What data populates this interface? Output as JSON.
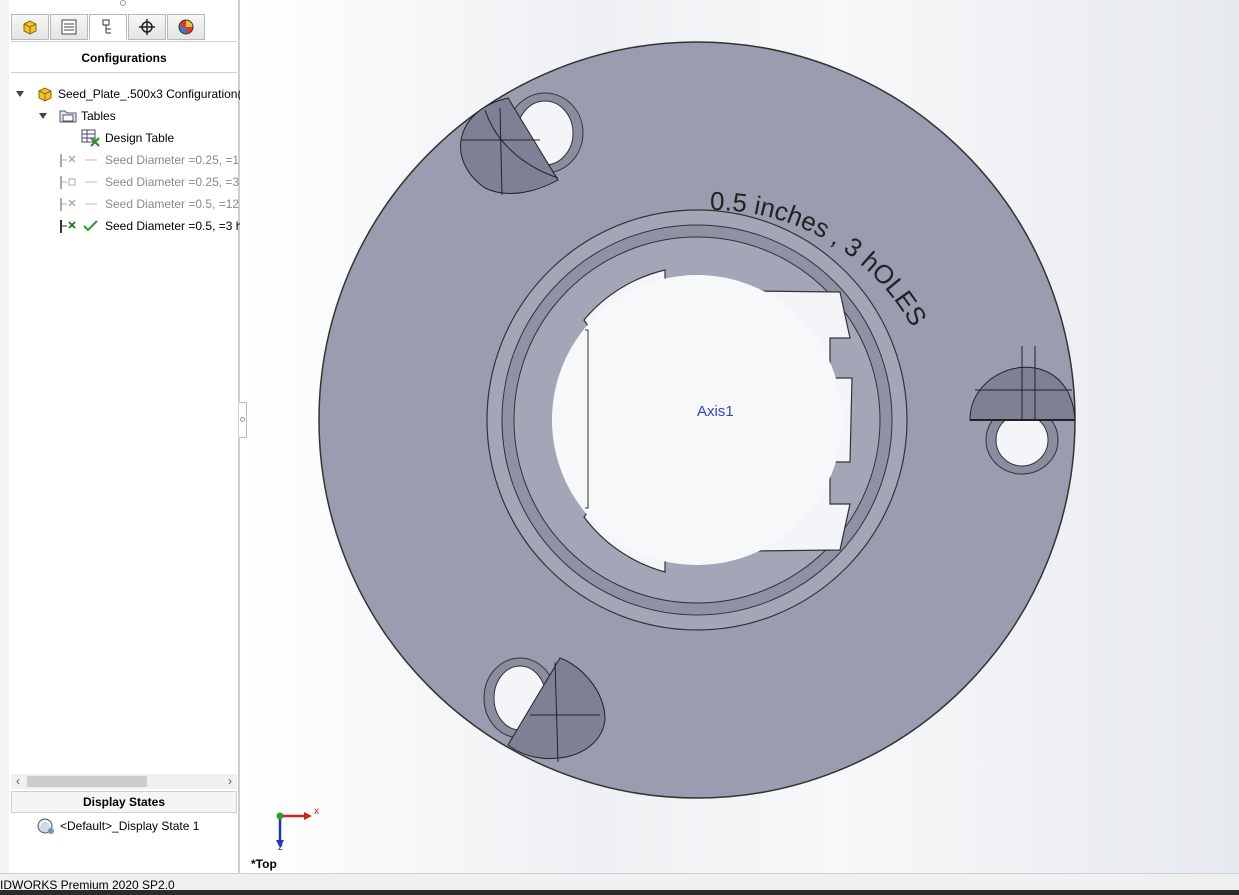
{
  "configuration_manager": {
    "header": "Configurations",
    "tabs": [
      "feature-manager-tab",
      "property-manager-tab",
      "configuration-manager-tab",
      "dimxpert-manager-tab",
      "display-manager-tab"
    ],
    "tree": {
      "root": "Seed_Plate_.500x3 Configuration(s",
      "tables_folder": "Tables",
      "design_table": "Design Table",
      "configurations": [
        {
          "label": "Seed Diameter =0.25, =1(",
          "active": false
        },
        {
          "label": "Seed Diameter =0.25, =3",
          "active": false
        },
        {
          "label": "Seed Diameter =0.5, =12",
          "active": false
        },
        {
          "label": "Seed Diameter =0.5, =3 h",
          "active": true
        }
      ]
    }
  },
  "display_states": {
    "header": "Display States",
    "items": [
      "<Default>_Display State 1"
    ]
  },
  "viewport": {
    "axis_label": "Axis1",
    "engraved_text": "0.5 inches , 3 hOLES",
    "view_orientation": "*Top",
    "triad": {
      "x": "x",
      "z": "z"
    },
    "part_color": "#9a9db0"
  },
  "status_bar": {
    "text": "IDWORKS Premium 2020 SP2.0"
  }
}
